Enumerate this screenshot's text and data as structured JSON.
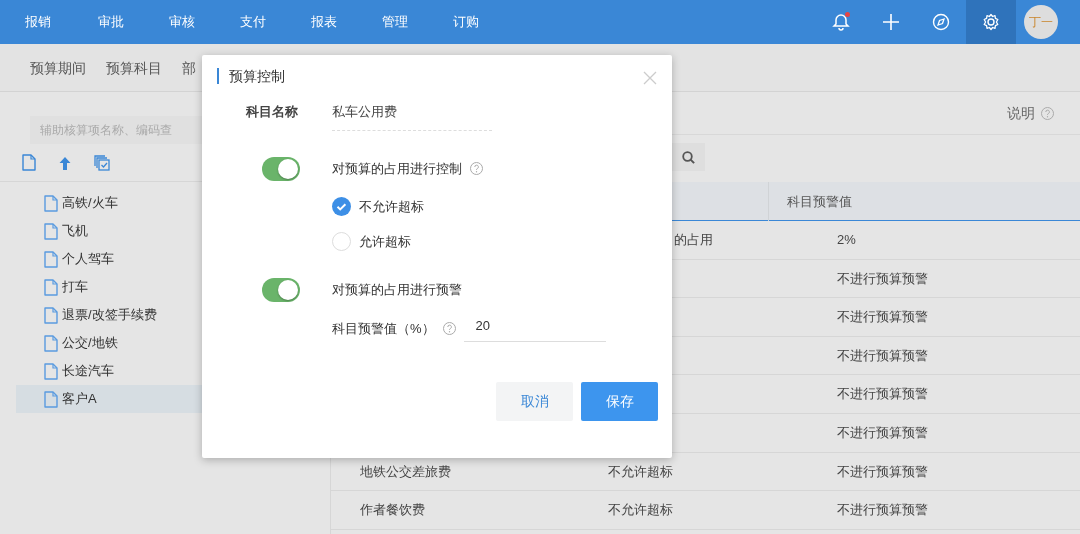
{
  "top_nav": {
    "items": [
      "报销",
      "审批",
      "审核",
      "支付",
      "报表",
      "管理",
      "订购"
    ],
    "icons": [
      {
        "kind": "bell",
        "notification": true,
        "selected": false
      },
      {
        "kind": "plus",
        "notification": false,
        "selected": false
      },
      {
        "kind": "compass",
        "notification": false,
        "selected": false
      },
      {
        "kind": "settings",
        "notification": false,
        "selected": true
      }
    ],
    "avatar": "丁一"
  },
  "sub_tabs": [
    {
      "label": "预算期间",
      "selected": false
    },
    {
      "label": "预算科目",
      "selected": false
    },
    {
      "label": "部",
      "selected": false
    }
  ],
  "sidebar": {
    "search": {
      "placeholder": "辅助核算项名称、编码查"
    },
    "items": [
      {
        "label": "高铁/火车",
        "selected": false
      },
      {
        "label": "飞机",
        "selected": false
      },
      {
        "label": "个人驾车",
        "selected": false
      },
      {
        "label": "打车",
        "selected": false
      },
      {
        "label": "退票/改签手续费",
        "selected": false
      },
      {
        "label": "公交/地铁",
        "selected": false
      },
      {
        "label": "长途汽车",
        "selected": false
      },
      {
        "label": "客户A",
        "selected": true
      }
    ]
  },
  "main": {
    "help_label": "说明",
    "table": {
      "column_3": "科目预警值",
      "rows": [
        {
          "column_2": "的占用",
          "column_3": "2%",
          "column_2_clipped": true
        },
        {
          "column_3": "不进行预算预警"
        },
        {
          "column_3": "不进行预算预警"
        },
        {
          "column_3": "不进行预算预警"
        },
        {
          "column_3": "不进行预算预警"
        },
        {
          "column_3": "不进行预算预警"
        },
        {
          "column_1": "地铁公交差旅费",
          "column_2": "不允许超标",
          "column_3": "不进行预算预警"
        },
        {
          "column_1": "作者餐饮费",
          "column_2": "不允许超标",
          "column_3": "不进行预算预警"
        }
      ]
    }
  },
  "dialog": {
    "title": "预算控制",
    "name_label": "科目名称",
    "name_value": "私车公用费",
    "control": {
      "on": true,
      "label": "对预算的占用进行控制",
      "options": [
        {
          "label": "不允许超标",
          "selected": true
        },
        {
          "label": "允许超标",
          "selected": false
        }
      ]
    },
    "warning": {
      "on": true,
      "label": "对预算的占用进行预警",
      "threshold_label": "科目预警值（%）",
      "threshold_value": "20"
    },
    "buttons": [
      {
        "label": "取消",
        "kind": "secondary"
      },
      {
        "label": "保存",
        "kind": "primary"
      }
    ]
  }
}
